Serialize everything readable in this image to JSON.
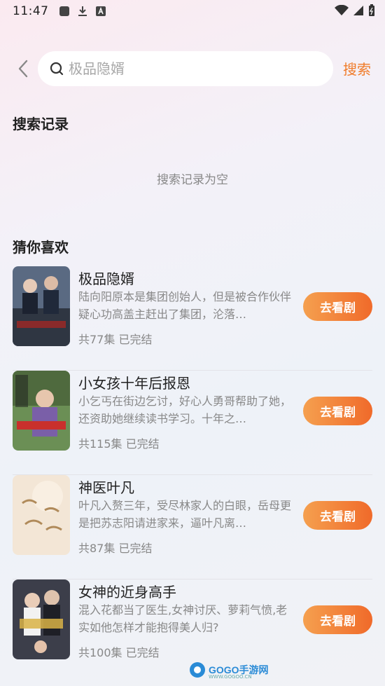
{
  "status_bar": {
    "time": "11:47"
  },
  "search": {
    "placeholder": "极品隐婿",
    "submit_label": "搜索"
  },
  "history": {
    "title": "搜索记录",
    "empty_text": "搜索记录为空"
  },
  "recommend": {
    "title": "猜你喜欢",
    "button_label": "去看剧",
    "items": [
      {
        "title": "极品隐婿",
        "desc": "陆向阳原本是集团创始人，但是被合作伙伴疑心功高盖主赶出了集团，沦落…",
        "meta": "共77集 已完结",
        "cover_color": "#5a6a82"
      },
      {
        "title": "小女孩十年后报恩",
        "desc": "小乞丐在街边乞讨，好心人勇哥帮助了她，还资助她继续读书学习。十年之…",
        "meta": "共115集 已完结",
        "cover_color": "#6b8f55"
      },
      {
        "title": "神医叶凡",
        "desc": "叶凡入赘三年，受尽林家人的白眼，岳母更是把苏志阳请进家来，逼叶凡离…",
        "meta": "共87集 已完结",
        "cover_color": "#f3e6d6"
      },
      {
        "title": "女神的近身高手",
        "desc": "混入花都当了医生,女神讨厌、萝莉气愤,老实如他怎样才能抱得美人归?",
        "meta": "共100集 已完结",
        "cover_color": "#3c3e4a"
      }
    ]
  },
  "watermark": {
    "text": "GOGO手游网",
    "sub": "WWW.GOGOO.CN"
  }
}
